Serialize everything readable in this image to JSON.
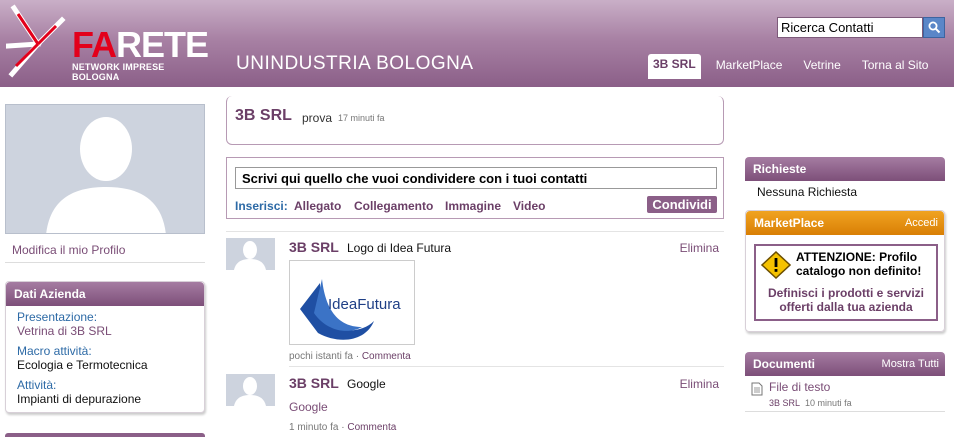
{
  "header": {
    "logo_title_red": "FA",
    "logo_title_white": "RETE",
    "logo_subtitle": "NETWORK IMPRESE BOLOGNA",
    "site_name": "UNINDUSTRIA BOLOGNA",
    "search_value": "Ricerca Contatti",
    "nav": [
      "3B SRL",
      "MarketPlace",
      "Vetrine",
      "Torna al Sito"
    ],
    "colors": {
      "header": "#8b5f88",
      "accent": "#6b3f67",
      "logo_red": "#e3001b"
    }
  },
  "left": {
    "edit_profile": "Modifica il mio Profilo",
    "dati_title": "Dati Azienda",
    "presentazione_label": "Presentazione:",
    "presentazione_value": "Vetrina di 3B SRL",
    "macro_label": "Macro attività:",
    "macro_value": "Ecologia e Termotecnica",
    "attivita_label": "Attività:",
    "attivita_value": "Impianti di depurazione"
  },
  "status": {
    "name": "3B SRL",
    "message": "prova",
    "time": "17 minuti fa"
  },
  "share": {
    "input_value": "Scrivi qui quello che vuoi condividere con i tuoi contatti",
    "inserisci": "Inserisci:",
    "links": [
      "Allegato",
      "Collegamento",
      "Immagine",
      "Video"
    ],
    "button": "Condividi"
  },
  "posts": [
    {
      "author": "3B SRL",
      "text": "Logo di Idea Futura",
      "delete": "Elimina",
      "image_text": "IdeaFutura",
      "time": "pochi istanti fa",
      "comment": "Commenta"
    },
    {
      "author": "3B SRL",
      "text": "Google",
      "delete": "Elimina",
      "link": "Google",
      "time": "1 minuto fa",
      "comment": "Commenta"
    }
  ],
  "right": {
    "richieste_title": "Richieste",
    "richieste_body": "Nessuna Richiesta",
    "market_title": "MarketPlace",
    "market_action": "Accedi",
    "warning": "ATTENZIONE: Profilo catalogo non definito!",
    "warning_link": "Definisci i prodotti e servizi offerti dalla tua azienda",
    "docs_title": "Documenti",
    "docs_action": "Mostra Tutti",
    "doc_name": "File di testo",
    "doc_owner": "3B SRL",
    "doc_time": "10 minuti fa"
  }
}
